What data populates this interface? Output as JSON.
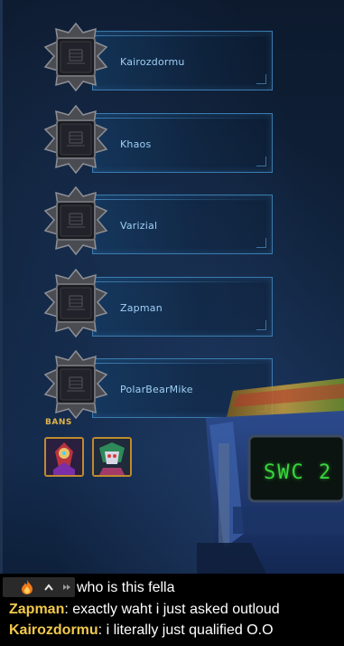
{
  "players": [
    {
      "name": "Kairozdormu"
    },
    {
      "name": "Khaos"
    },
    {
      "name": "Varizial"
    },
    {
      "name": "Zapman"
    },
    {
      "name": "PolarBearMike"
    }
  ],
  "bans": {
    "label": "BANS",
    "heroes": [
      {
        "icon": "hero-portrait-icon"
      },
      {
        "icon": "hero-portrait-icon"
      }
    ]
  },
  "screen": {
    "text": "SWC 2"
  },
  "chat": {
    "controls": [
      {
        "icon": "fire-icon"
      },
      {
        "icon": "chevron-up-icon"
      },
      {
        "icon": "fast-forward-icon"
      }
    ],
    "messages": [
      {
        "user": "",
        "text": "who is this fella"
      },
      {
        "user": "Zapman",
        "text": "exactly waht i just asked outloud"
      },
      {
        "user": "Kairozdormu",
        "text": "i literally just qualified O.O"
      }
    ]
  },
  "colors": {
    "name_text": "#9fd0f5",
    "bans_label": "#e0b34a",
    "chat_user": "#f2c94c",
    "screen_text": "#39d63d"
  }
}
